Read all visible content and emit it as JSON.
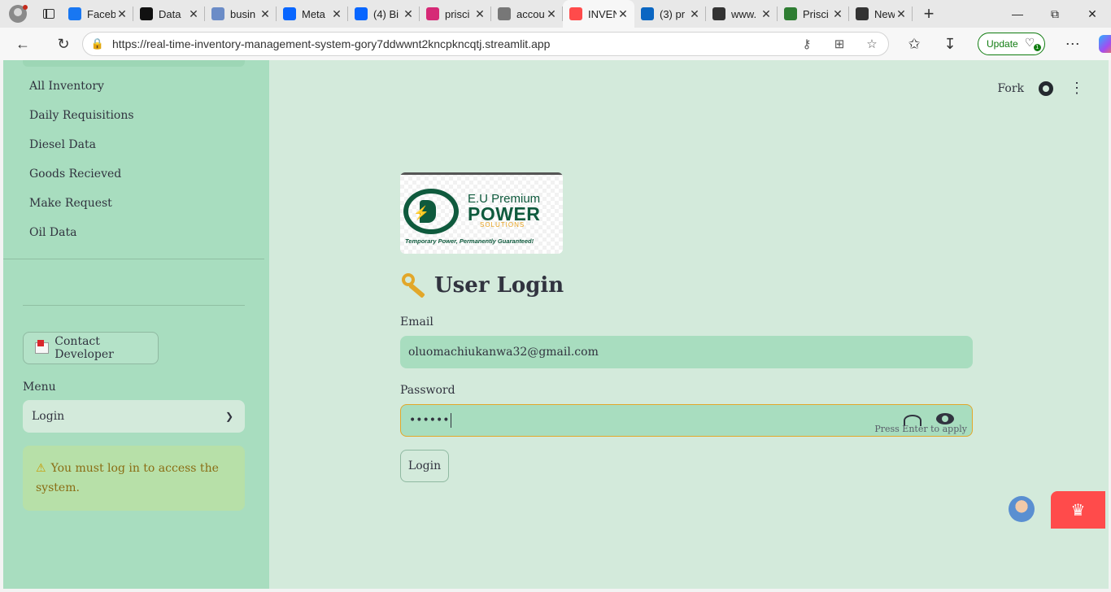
{
  "browser": {
    "tabs": [
      {
        "label": "Faceb",
        "icon": "facebook-icon",
        "color": "#1877f2"
      },
      {
        "label": "Data",
        "icon": "threads-icon",
        "color": "#111111"
      },
      {
        "label": "busin",
        "icon": "search-icon",
        "color": "#6b8cc7"
      },
      {
        "label": "Meta",
        "icon": "meta-icon",
        "color": "#0866ff"
      },
      {
        "label": "(4) Bi",
        "icon": "meta-icon",
        "color": "#0866ff"
      },
      {
        "label": "prisci",
        "icon": "instagram-icon",
        "color": "#d62976"
      },
      {
        "label": "accou",
        "icon": "globe-icon",
        "color": "#777777"
      },
      {
        "label": "INVEN",
        "icon": "streamlit-icon",
        "color": "#ff4b4b"
      },
      {
        "label": "(3) pr",
        "icon": "linkedin-icon",
        "color": "#0a66c2"
      },
      {
        "label": "www.",
        "icon": "document-icon",
        "color": "#333333"
      },
      {
        "label": "Prisci",
        "icon": "leaf-icon",
        "color": "#2e7d32"
      },
      {
        "label": "New",
        "icon": "newtab-icon",
        "color": "#333333"
      }
    ],
    "active_tab_index": 7,
    "url": "https://real-time-inventory-management-system-gory7ddwwnt2kncpkncqtj.streamlit.app",
    "update_label": "Update",
    "update_badge": "1"
  },
  "sidebar": {
    "nav_items": [
      "All Inventory",
      "Daily Requisitions",
      "Diesel Data",
      "Goods Recieved",
      "Make Request",
      "Oil Data"
    ],
    "contact_label": "Contact Developer",
    "menu_label": "Menu",
    "menu_selected": "Login",
    "warning_text": "You must log in to access the system."
  },
  "header": {
    "fork_label": "Fork"
  },
  "logo": {
    "line1": "E.U Premium",
    "line2": "POWER",
    "line3": "SOLUTIONS",
    "tagline": "Temporary Power, Permanently Guaranteed!"
  },
  "login": {
    "title": "User Login",
    "email_label": "Email",
    "email_value": "oluomachiukanwa32@gmail.com",
    "password_label": "Password",
    "password_value": "••••••",
    "hint": "Press Enter to apply",
    "button_label": "Login"
  },
  "colors": {
    "sidebar_bg": "#a8ddbf",
    "main_bg": "#d3eadb",
    "focus_border": "#e2a72a",
    "brand_green": "#0f5a3d",
    "streamlit_red": "#ff4b4b"
  }
}
